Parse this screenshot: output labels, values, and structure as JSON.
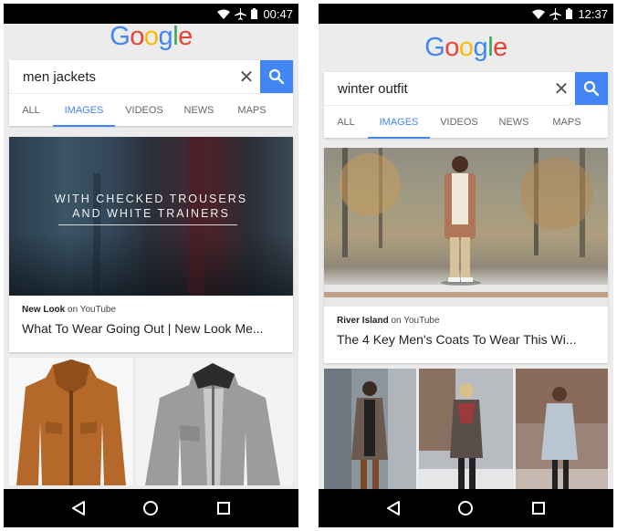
{
  "left": {
    "status": {
      "time": "00:47",
      "wifi_icon": "wifi-icon",
      "airplane_icon": "airplane-icon",
      "battery_icon": "battery-icon"
    },
    "logo_letters": [
      "G",
      "o",
      "o",
      "g",
      "l",
      "e"
    ],
    "search": {
      "query": "men jackets",
      "clear_icon": "close-icon",
      "search_icon": "search-icon"
    },
    "tabs": [
      "ALL",
      "IMAGES",
      "VIDEOS",
      "NEWS",
      "MAPS"
    ],
    "active_tab": "IMAGES",
    "result": {
      "overlay_line1": "WITH CHECKED TROUSERS",
      "overlay_line2": "AND WHITE TRAINERS",
      "source_name": "New Look",
      "source_suffix": "on YouTube",
      "title": "What To Wear Going Out | New Look Me..."
    }
  },
  "right": {
    "status": {
      "time": "12:37",
      "wifi_icon": "wifi-icon",
      "airplane_icon": "airplane-icon",
      "battery_icon": "battery-icon"
    },
    "logo_letters": [
      "G",
      "o",
      "o",
      "g",
      "l",
      "e"
    ],
    "search": {
      "query": "winter outfit",
      "clear_icon": "close-icon",
      "search_icon": "search-icon"
    },
    "tabs": [
      "ALL",
      "IMAGES",
      "VIDEOS",
      "NEWS",
      "MAPS"
    ],
    "active_tab": "IMAGES",
    "result": {
      "source_name": "River Island",
      "source_suffix": "on YouTube",
      "title": "The 4 Key Men's Coats To Wear This Wi..."
    }
  },
  "nav": {
    "back_icon": "back-triangle-icon",
    "home_icon": "home-circle-icon",
    "recents_icon": "recents-square-icon"
  },
  "colors": {
    "google_blue": "#4285f4",
    "google_red": "#ea4335",
    "google_yellow": "#fbbc05",
    "google_green": "#34a853"
  }
}
